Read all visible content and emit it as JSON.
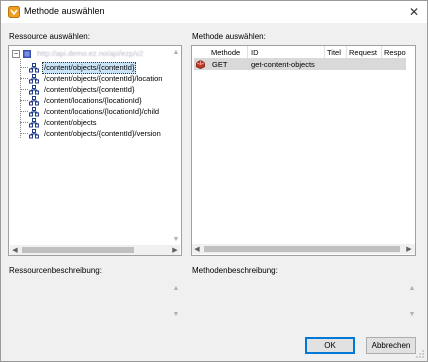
{
  "window": {
    "title": "Methode auswählen",
    "close_glyph": "✕"
  },
  "left_panel": {
    "label": "Ressource auswählen:",
    "root": "http://api.demo.ez.no/api/ezp/v2",
    "items": [
      {
        "label": "/content/objects/{contentId}",
        "selected": true
      },
      {
        "label": "/content/objects/{contentId}/location"
      },
      {
        "label": "/content/objects/{contentId}"
      },
      {
        "label": "/content/locations/{locationId}"
      },
      {
        "label": "/content/locations/{locationId}/child"
      },
      {
        "label": "/content/objects"
      },
      {
        "label": "/content/objects/{contentId}/version"
      }
    ]
  },
  "right_panel": {
    "label": "Methode auswählen:",
    "columns": [
      "Methode",
      "ID",
      "Titel",
      "Request",
      "Respo"
    ],
    "rows": [
      {
        "method": "GET",
        "id": "get-content-objects",
        "titel": "",
        "request": "",
        "response": ""
      }
    ]
  },
  "resource_description": {
    "label": "Ressourcenbeschreibung:"
  },
  "method_description": {
    "label": "Methodenbeschreibung:"
  },
  "buttons": {
    "ok": "OK",
    "cancel": "Abbrechen"
  },
  "icons": {
    "app": "method-dialog-icon",
    "root": "api-root-icon",
    "resource": "resource-node-icon",
    "method": "get-method-icon"
  },
  "colors": {
    "selection": "#cce4f7",
    "row_selection": "#d9d9d9",
    "default_button_border": "#0078d7",
    "app_icon": "#f0a020",
    "method_icon": "#c0392b"
  }
}
